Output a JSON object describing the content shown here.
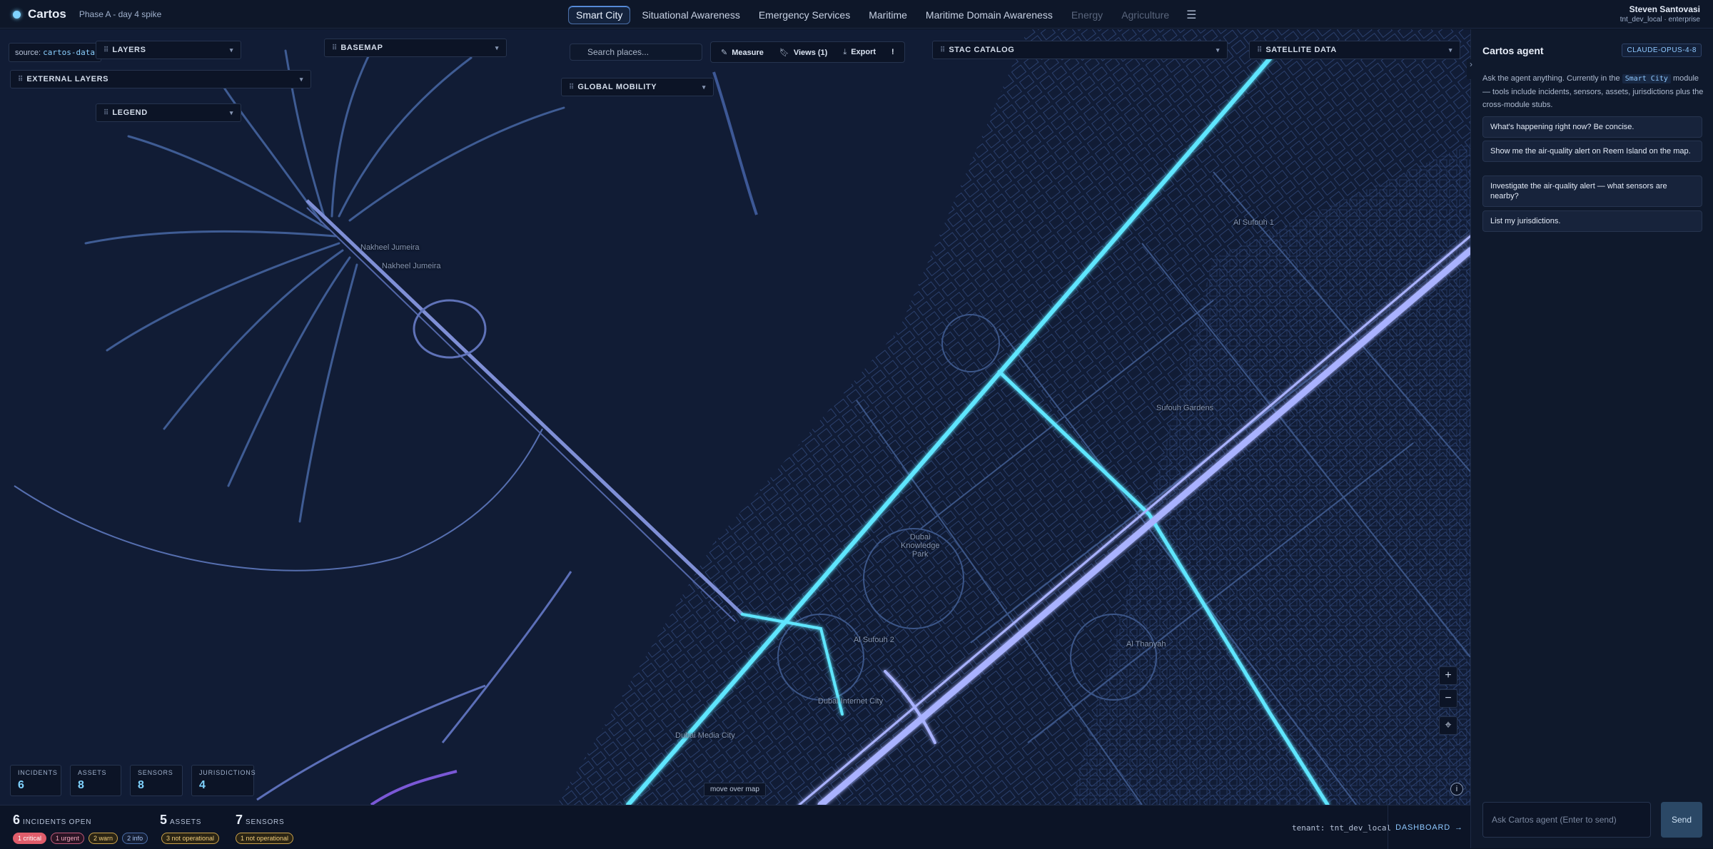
{
  "app": {
    "name": "Cartos",
    "phase": "Phase A - day 4 spike"
  },
  "nav": {
    "tabs": [
      {
        "label": "Smart City",
        "state": "active"
      },
      {
        "label": "Situational Awareness",
        "state": "normal"
      },
      {
        "label": "Emergency Services",
        "state": "normal"
      },
      {
        "label": "Maritime",
        "state": "normal"
      },
      {
        "label": "Maritime Domain Awareness",
        "state": "normal"
      },
      {
        "label": "Energy",
        "state": "disabled"
      },
      {
        "label": "Agriculture",
        "state": "disabled"
      }
    ],
    "menu_icon": "☰"
  },
  "user": {
    "name": "Steven Santovasi",
    "tenant_line": "tnt_dev_local · enterprise"
  },
  "map": {
    "source_prefix": "source:",
    "source_value": "cartos-data",
    "panels": {
      "layers": "LAYERS",
      "external_layers": "EXTERNAL LAYERS",
      "legend": "LEGEND",
      "basemap": "BASEMAP",
      "global_mobility": "GLOBAL MOBILITY",
      "stac_catalog": "STAC CATALOG",
      "satellite_data": "SATELLITE DATA"
    },
    "search_placeholder": "Search places...",
    "toolbar": {
      "measure": "Measure",
      "views": "Views (1)",
      "export": "Export",
      "alert": "!"
    },
    "place_labels": {
      "nakheel1": "Nakheel Jumeira",
      "nakheel2": "Nakheel Jumeira",
      "al_sufouh_1": "Al Sufouh 1",
      "sufouh_gardens": "Sufouh Gardens",
      "dubai_knowledge_park": "Dubai\nKnowledge\nPark",
      "al_sufouh_2": "Al Sufouh 2",
      "al_thanyah": "Al Thanyah",
      "dubai_internet_city": "Dubai Internet City",
      "dubai_media_city": "Dubai Media City"
    },
    "zoom": {
      "in": "+",
      "out": "−",
      "locate": "⌖"
    },
    "cursor_readout": "move over map",
    "info_icon": "i"
  },
  "stats": [
    {
      "label": "INCIDENTS",
      "value": "6"
    },
    {
      "label": "ASSETS",
      "value": "8"
    },
    {
      "label": "SENSORS",
      "value": "8"
    },
    {
      "label": "JURISDICTIONS",
      "value": "4"
    }
  ],
  "bottom": {
    "incidents": {
      "count": "6",
      "word": "INCIDENTS OPEN"
    },
    "incident_pills": {
      "critical": "1 critical",
      "urgent": "1 urgent",
      "warn": "2 warn",
      "info": "2 info"
    },
    "assets": {
      "count": "5",
      "word": "ASSETS"
    },
    "asset_pills": {
      "not_operational": "3 not operational"
    },
    "sensors": {
      "count": "7",
      "word": "SENSORS"
    },
    "sensor_pills": {
      "not_operational": "1 not operational"
    },
    "tenant": "tenant: tnt_dev_local",
    "dashboard": "DASHBOARD",
    "dashboard_arrow": "→"
  },
  "agent": {
    "title": "Cartos agent",
    "model": "CLAUDE-OPUS-4-8",
    "collapse_icon": "›",
    "intro_before": "Ask the agent anything. Currently in the",
    "intro_module": "Smart City",
    "intro_after": "module — tools include incidents, sensors, assets, jurisdictions plus the cross-module stubs.",
    "suggestions": [
      "What's happening right now? Be concise.",
      "Show me the air-quality alert on Reem Island on the map.",
      "Investigate the air-quality alert — what sensors are nearby?",
      "List my jurisdictions."
    ],
    "input_placeholder": "Ask Cartos agent (Enter to send)",
    "send": "Send"
  },
  "colors": {
    "background": "#0b1324",
    "map_land": "#101b33",
    "highway_cyan": "#5fe6ff",
    "highway_lavender": "#a9b2ff",
    "street": "#3c5688",
    "accent": "#7fd3ff",
    "critical": "#e05d6b"
  }
}
